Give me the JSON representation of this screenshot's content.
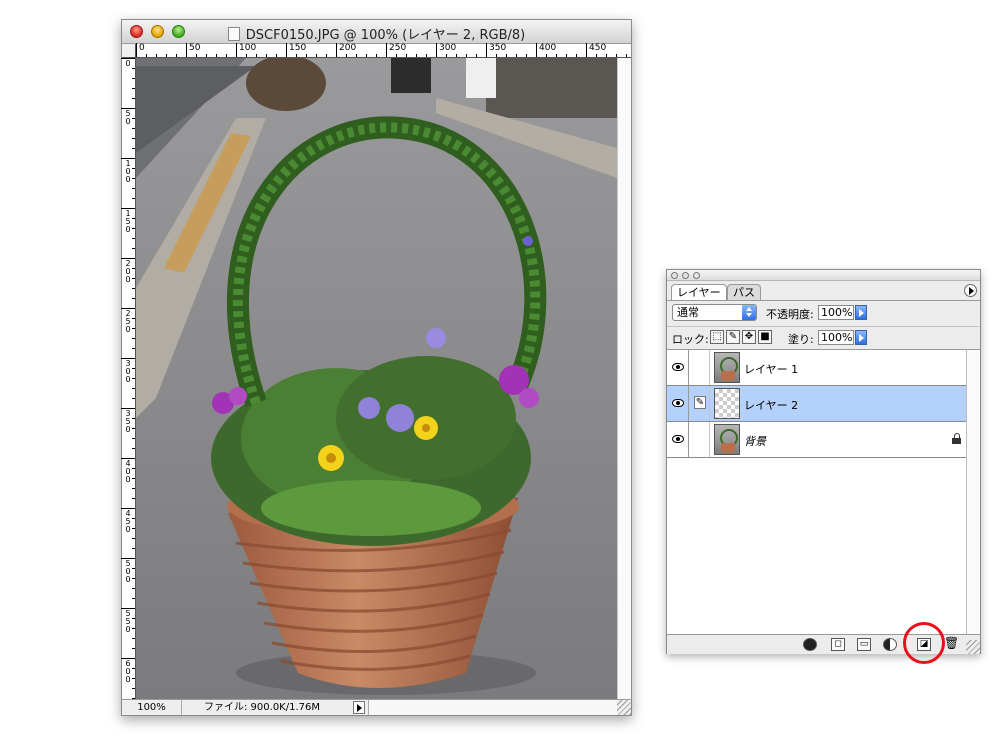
{
  "document_window": {
    "title": "DSCF0150.JPG @ 100% (レイヤー 2, RGB/8)",
    "ruler_h_labels": [
      "0",
      "50",
      "100",
      "150",
      "200",
      "250",
      "300",
      "350",
      "400",
      "450"
    ],
    "ruler_v_labels": [
      "0",
      "5\n0",
      "1\n0\n0",
      "1\n5\n0",
      "2\n0\n0",
      "2\n5\n0",
      "3\n0\n0",
      "3\n5\n0",
      "4\n0\n0",
      "4\n5\n0",
      "5\n0\n0",
      "5\n5\n0",
      "6\n0\n0"
    ],
    "status": {
      "zoom": "100%",
      "file_info": "ファイル: 900.0K/1.76M"
    },
    "canvas_image": "photo of a terracotta flower pot with a green vine arch handle, yellow and purple flowers, on a gray asphalt street"
  },
  "layers_panel": {
    "tabs": [
      "レイヤー",
      "パス"
    ],
    "active_tab": 0,
    "blend_mode": "通常",
    "opacity_label": "不透明度:",
    "opacity_value": "100%",
    "lock_label": "ロック:",
    "fill_label": "塗り:",
    "fill_value": "100%",
    "layers": [
      {
        "name": "レイヤー 1",
        "visible": true,
        "selected": false,
        "thumbnail": "photo",
        "locked": false
      },
      {
        "name": "レイヤー 2",
        "visible": true,
        "selected": true,
        "thumbnail": "transparent",
        "locked": false
      },
      {
        "name": "背景",
        "visible": true,
        "selected": false,
        "thumbnail": "photo",
        "locked": true
      }
    ],
    "footer_buttons": [
      "layer-style-icon",
      "layer-mask-icon",
      "new-set-icon",
      "adjustment-layer-icon",
      "new-layer-icon",
      "trash-icon"
    ],
    "highlight_color": "#e8101c"
  }
}
